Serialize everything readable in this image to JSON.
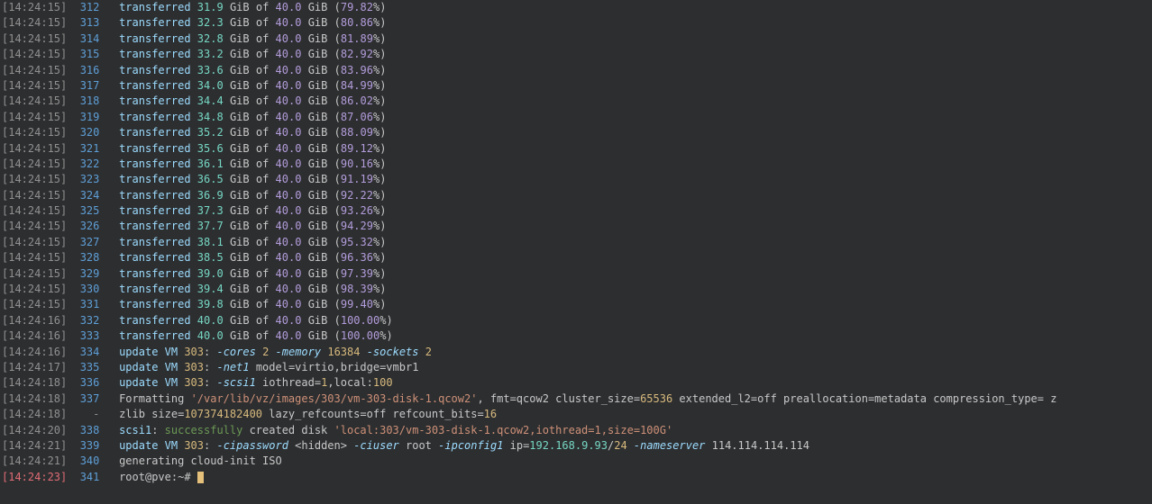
{
  "transfer_lines": [
    {
      "ts": "14:24:15",
      "ln": "312",
      "done": "31.9",
      "total": "40.0",
      "pct": "79.82"
    },
    {
      "ts": "14:24:15",
      "ln": "313",
      "done": "32.3",
      "total": "40.0",
      "pct": "80.86"
    },
    {
      "ts": "14:24:15",
      "ln": "314",
      "done": "32.8",
      "total": "40.0",
      "pct": "81.89"
    },
    {
      "ts": "14:24:15",
      "ln": "315",
      "done": "33.2",
      "total": "40.0",
      "pct": "82.92"
    },
    {
      "ts": "14:24:15",
      "ln": "316",
      "done": "33.6",
      "total": "40.0",
      "pct": "83.96"
    },
    {
      "ts": "14:24:15",
      "ln": "317",
      "done": "34.0",
      "total": "40.0",
      "pct": "84.99"
    },
    {
      "ts": "14:24:15",
      "ln": "318",
      "done": "34.4",
      "total": "40.0",
      "pct": "86.02"
    },
    {
      "ts": "14:24:15",
      "ln": "319",
      "done": "34.8",
      "total": "40.0",
      "pct": "87.06"
    },
    {
      "ts": "14:24:15",
      "ln": "320",
      "done": "35.2",
      "total": "40.0",
      "pct": "88.09"
    },
    {
      "ts": "14:24:15",
      "ln": "321",
      "done": "35.6",
      "total": "40.0",
      "pct": "89.12"
    },
    {
      "ts": "14:24:15",
      "ln": "322",
      "done": "36.1",
      "total": "40.0",
      "pct": "90.16"
    },
    {
      "ts": "14:24:15",
      "ln": "323",
      "done": "36.5",
      "total": "40.0",
      "pct": "91.19"
    },
    {
      "ts": "14:24:15",
      "ln": "324",
      "done": "36.9",
      "total": "40.0",
      "pct": "92.22"
    },
    {
      "ts": "14:24:15",
      "ln": "325",
      "done": "37.3",
      "total": "40.0",
      "pct": "93.26"
    },
    {
      "ts": "14:24:15",
      "ln": "326",
      "done": "37.7",
      "total": "40.0",
      "pct": "94.29"
    },
    {
      "ts": "14:24:15",
      "ln": "327",
      "done": "38.1",
      "total": "40.0",
      "pct": "95.32"
    },
    {
      "ts": "14:24:15",
      "ln": "328",
      "done": "38.5",
      "total": "40.0",
      "pct": "96.36"
    },
    {
      "ts": "14:24:15",
      "ln": "329",
      "done": "39.0",
      "total": "40.0",
      "pct": "97.39"
    },
    {
      "ts": "14:24:15",
      "ln": "330",
      "done": "39.4",
      "total": "40.0",
      "pct": "98.39"
    },
    {
      "ts": "14:24:15",
      "ln": "331",
      "done": "39.8",
      "total": "40.0",
      "pct": "99.40"
    },
    {
      "ts": "14:24:16",
      "ln": "332",
      "done": "40.0",
      "total": "40.0",
      "pct": "100.00"
    },
    {
      "ts": "14:24:16",
      "ln": "333",
      "done": "40.0",
      "total": "40.0",
      "pct": "100.00"
    }
  ],
  "word": {
    "transferred": "transferred",
    "gib": "GiB",
    "of": "of",
    "update_vm": "update VM ",
    "vm_id": "303"
  },
  "l334": {
    "ts": "14:24:16",
    "ln": "334",
    "opt_cores": "-cores",
    "cores": "2",
    "opt_memory": "-memory",
    "memory": "16384",
    "opt_sockets": "-sockets",
    "sockets": "2"
  },
  "l335": {
    "ts": "14:24:17",
    "ln": "335",
    "opt_net": "-net1",
    "kv": " model=virtio,bridge=vmbr1"
  },
  "l336": {
    "ts": "14:24:18",
    "ln": "336",
    "opt_scsi": "-scsi1",
    "kv1": " iothread=",
    "v1": "1",
    "kv2": ",local:",
    "v2": "100"
  },
  "l337": {
    "ts": "14:24:18",
    "ln": "337",
    "pre": "Formatting ",
    "path": "'/var/lib/vz/images/303/vm-303-disk-1.qcow2'",
    "mid": ", fmt=qcow2 cluster_size=",
    "cs": "65536",
    "mid2": " extended_l2=off preallocation=metadata compression_type= ",
    "tail": "z"
  },
  "l337b": {
    "ts": "14:24:18",
    "ln": "-",
    "pre": "zlib size=",
    "size": "107374182400",
    "mid": " lazy_refcounts=off refcount_bits=",
    "bits": "16"
  },
  "l338": {
    "ts": "14:24:20",
    "ln": "338",
    "scsi": "scsi1",
    "colon": ": ",
    "success": "successfully",
    "mid": " created disk ",
    "path": "'local:303/vm-303-disk-1.qcow2,iothread=1,size=100G'"
  },
  "l339": {
    "ts": "14:24:21",
    "ln": "339",
    "opt_cipw": "-cipassword",
    "hidden": " <hidden> ",
    "opt_ciuser": "-ciuser",
    "user": " root ",
    "opt_ipconfig": "-ipconfig1",
    "ip_pre": " ip=",
    "ip": "192.168.9.93",
    "slash": "/",
    "mask": "24",
    "sp": " ",
    "opt_ns": "-nameserver",
    "ns": " 114.114.114.114"
  },
  "l340": {
    "ts": "14:24:21",
    "ln": "340",
    "text": "generating cloud-init ISO"
  },
  "l341": {
    "ts": "14:24:23",
    "ln": "341",
    "prompt": "root@pve:~# "
  }
}
